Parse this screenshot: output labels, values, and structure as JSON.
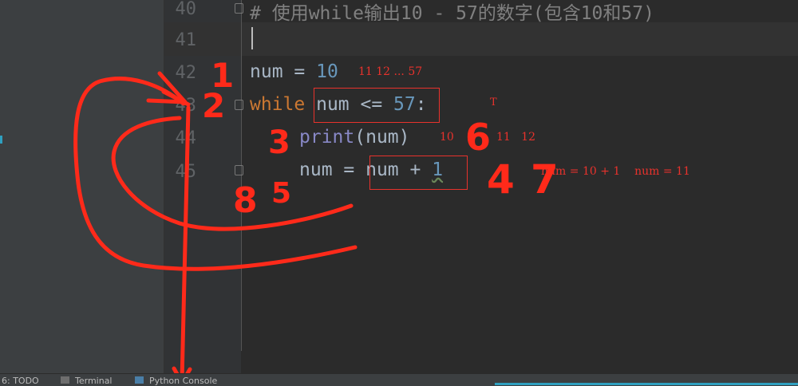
{
  "editor": {
    "line_numbers": [
      "40",
      "41",
      "42",
      "43",
      "44",
      "45"
    ],
    "lines": {
      "l40_comment": "# 使用while输出10 - 57的数字(包含10和57)",
      "l42_var": "num",
      "l42_op": " = ",
      "l42_val": "10",
      "l43_kw": "while",
      "l43_cond_var": "num",
      "l43_cond_op": " <= ",
      "l43_cond_val": "57",
      "l43_colon": ":",
      "l44_func": "print",
      "l44_args": "(num)",
      "l45_var": "num",
      "l45_op": " = ",
      "l45_expr_var": "num",
      "l45_expr_op": " + ",
      "l45_expr_val": "1"
    }
  },
  "annotations": {
    "seq_text": "11 12 ... 57",
    "true_mark": "T",
    "print_first": "10",
    "print_more": "11   12",
    "assign_text": "num = 10 + 1    num = 11",
    "steps": [
      "1",
      "2",
      "3",
      "4",
      "5",
      "6",
      "7",
      "8"
    ],
    "ink_color": "#ff2a1a"
  },
  "statusbar": {
    "todo": "6: TODO",
    "terminal": "Terminal",
    "python_console": "Python Console"
  }
}
